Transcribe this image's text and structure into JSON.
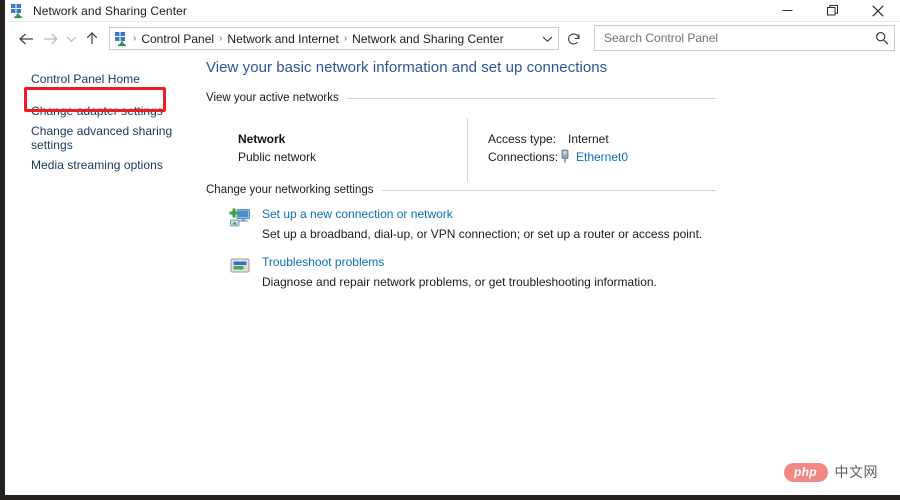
{
  "window": {
    "title": "Network and Sharing Center",
    "icon": "network-sharing-icon",
    "controls": {
      "minimize": "Minimize",
      "restore": "Restore",
      "close": "Close"
    }
  },
  "navigation": {
    "back": "Back",
    "forward": "Forward",
    "recent": "Recent locations",
    "up": "Up",
    "breadcrumb": {
      "icon": "network-sharing-icon",
      "items": [
        "Control Panel",
        "Network and Internet",
        "Network and Sharing Center"
      ],
      "separator": "›",
      "dropdown": "Previous locations"
    },
    "refresh": "Refresh"
  },
  "search": {
    "placeholder": "Search Control Panel",
    "value": "",
    "icon": "search-icon"
  },
  "sidebar": {
    "items": [
      {
        "label": "Control Panel Home",
        "highlighted": false
      },
      {
        "label": "Change adapter settings",
        "highlighted": true
      },
      {
        "label": "Change advanced sharing settings",
        "highlighted": false
      },
      {
        "label": "Media streaming options",
        "highlighted": false
      }
    ]
  },
  "main": {
    "page_title": "View your basic network information and set up connections",
    "sections": [
      {
        "label": "View your active networks"
      },
      {
        "label": "Change your networking settings"
      }
    ],
    "active_network": {
      "name": "Network",
      "type": "Public network",
      "details": [
        {
          "label": "Access type:",
          "value": "Internet"
        },
        {
          "label": "Connections:",
          "value": "Ethernet0",
          "icon": "ethernet-plug-icon",
          "is_link": true
        }
      ]
    },
    "tasks": [
      {
        "icon": "new-connection-icon",
        "link": "Set up a new connection or network",
        "description": "Set up a broadband, dial-up, or VPN connection; or set up a router or access point."
      },
      {
        "icon": "troubleshoot-icon",
        "link": "Troubleshoot problems",
        "description": "Diagnose and repair network problems, or get troubleshooting information."
      }
    ]
  },
  "watermark": {
    "badge": "php",
    "text": "中文网"
  },
  "colors": {
    "highlight_box": "#ee1d23",
    "link": "#0b6eb8",
    "sidebar_link": "#17365d",
    "page_title": "#2f5496",
    "watermark_badge": "#f2817e"
  }
}
